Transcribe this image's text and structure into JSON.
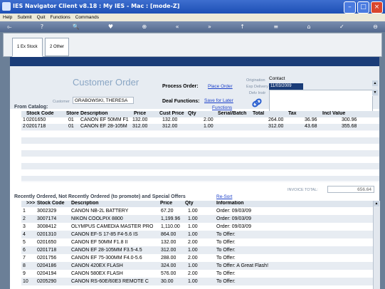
{
  "window": {
    "title": "IES Navigator Client v8.18 : My IES - Mac :        [mode-Z]"
  },
  "menu": [
    "Help",
    "Submit",
    "Quit",
    "Functions",
    "Commands"
  ],
  "toolbar": [
    "⟜",
    "?",
    "🔍",
    "♥",
    "⊕",
    "«",
    "»",
    "↑",
    "≡",
    "⌂",
    "✓",
    "⊖"
  ],
  "tabs": [
    {
      "label": "1 Ex Stock"
    },
    {
      "label": "2 Other"
    }
  ],
  "order": {
    "title": "Customer Order",
    "customer_label": "Customer",
    "customer_value": "GRABOWSKI, THERESA",
    "process_label": "Process Order:",
    "place_order": "Place Order",
    "deal_label": "Deal Functions:",
    "save_later": "Save for Later",
    "functions": "Functions",
    "origination_label": "Origination",
    "exp_delivery_label": "Exp Delivery",
    "delv_instr_label": "Delv Instr",
    "contact_label": "Contact",
    "date_value": "11/03/2009"
  },
  "catalog": {
    "title": "From Catalog:",
    "headers": [
      "Stock Code",
      "Store",
      "Description",
      "Price",
      "Cust Price",
      "Qty",
      "Serial/Batch",
      "Total",
      "Tax",
      "Incl Value"
    ],
    "rows": [
      [
        "1",
        "0201650",
        "01",
        "CANON EF 50MM F1",
        "132.00",
        "132.00",
        "2.00",
        "",
        "264.00",
        "36.96",
        "300.96"
      ],
      [
        "2",
        "0201718",
        "01",
        "CANON EF 28-105M",
        "312.00",
        "312.00",
        "1.00",
        "",
        "312.00",
        "43.68",
        "355.68"
      ]
    ],
    "invoice_label": "INVOICE TOTAL:",
    "invoice_total": "656.64"
  },
  "recent": {
    "title": "Recently Ordered, Not Recently Ordered (to promote) and Special Offers",
    "resort": "Re-Sort",
    "headers": [
      ">>>",
      "Stock Code",
      "Description",
      "Price",
      "Qty",
      "Information"
    ],
    "rows": [
      [
        "1",
        "3002329",
        "CANON NB-2L BATTERY",
        "67.20",
        "1.00",
        "Order: 09/03/09"
      ],
      [
        "2",
        "3007174",
        "NIKON COOLPIX 8800",
        "1,199.96",
        "1.00",
        "Order: 09/03/09"
      ],
      [
        "3",
        "3008412",
        "OLYMPUS CAMEDIA MASTER PRO",
        "1,110.00",
        "1.00",
        "Order: 09/03/09"
      ],
      [
        "4",
        "0201310",
        "CANON EF-S 17-85 F4-5.6 IS",
        "864.00",
        "1.00",
        "To Offer:"
      ],
      [
        "5",
        "0201650",
        "CANON EF 50MM F1.8 II",
        "132.00",
        "2.00",
        "To Offer:"
      ],
      [
        "6",
        "0201718",
        "CANON EF 28-105MM F3.5-4.5",
        "312.00",
        "1.00",
        "To Offer:"
      ],
      [
        "7",
        "0201756",
        "CANON EF 75-300MM F4.0-5.6",
        "288.00",
        "2.00",
        "To Offer:"
      ],
      [
        "8",
        "0204186",
        "CANON 420EX FLASH",
        "324.00",
        "1.00",
        "To Offer: A Great Flash!"
      ],
      [
        "9",
        "0204194",
        "CANON 580EX FLASH",
        "576.00",
        "2.00",
        "To Offer:"
      ],
      [
        "10",
        "0205290",
        "CANON RS-60E/60E3 REMOTE C",
        "30.00",
        "1.00",
        "To Offer:"
      ]
    ]
  },
  "colors": {
    "title_bar": "#2358c0",
    "header_band": "#1a3c78",
    "link": "#1a3fc9"
  }
}
